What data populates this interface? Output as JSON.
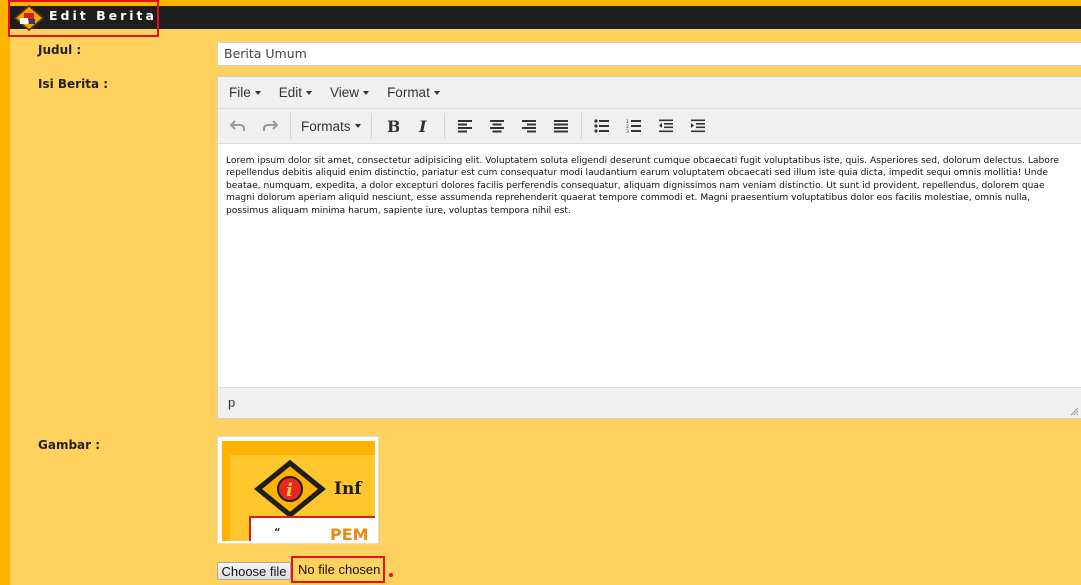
{
  "header": {
    "title": "Edit Berita"
  },
  "form": {
    "judul_label": "Judul :",
    "judul_value": "Berita Umum",
    "isi_label": "Isi Berita :",
    "gambar_label": "Gambar :"
  },
  "editor": {
    "menu": [
      "File",
      "Edit",
      "View",
      "Format"
    ],
    "formats_label": "Formats",
    "content": "Lorem ipsum dolor sit amet, consectetur adipisicing elit. Voluptatem soluta eligendi deserunt cumque obcaecati fugit voluptatibus iste, quis. Asperiores sed, dolorum delectus. Labore repellendus debitis aliquid enim distinctio, pariatur est cum consequatur modi laudantium earum voluptatem obcaecati sed illum iste quia dicta, impedit sequi omnis mollitia! Unde beatae, numquam, expedita, a dolor excepturi dolores facilis perferendis consequatur, aliquam dignissimos nam veniam distinctio. Ut sunt id provident, repellendus, dolorem quae magni dolorum aperiam aliquid nesciunt, esse assumenda reprehenderit quaerat tempore commodi et. Magni praesentium voluptatibus dolor eos facilis molestiae, omnis nulla, possimus aliquam minima harum, sapiente iure, voluptas tempora nihil est.",
    "status_path": "p"
  },
  "image": {
    "visible_text_1": "Inf",
    "visible_text_2": "PEM"
  },
  "file_input": {
    "button_label": "Choose file",
    "status": "No file chosen"
  },
  "colors": {
    "background": "#ffd260",
    "accent": "#ffb400",
    "titlebar": "#1e1e1e",
    "highlight": "#e0141c"
  }
}
